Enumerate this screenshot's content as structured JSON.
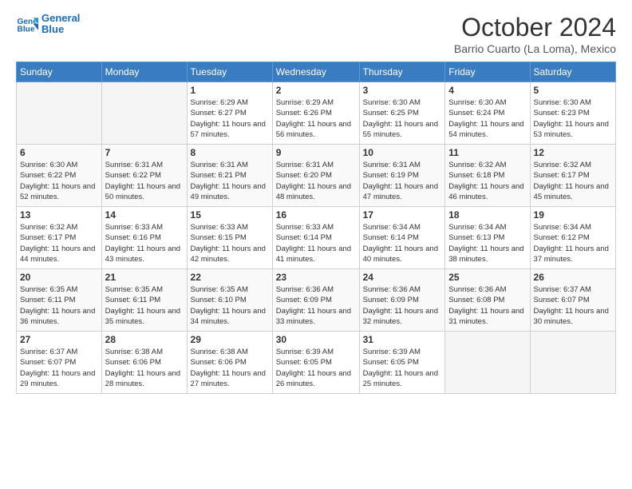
{
  "header": {
    "logo_line1": "General",
    "logo_line2": "Blue",
    "month_title": "October 2024",
    "subtitle": "Barrio Cuarto (La Loma), Mexico"
  },
  "weekdays": [
    "Sunday",
    "Monday",
    "Tuesday",
    "Wednesday",
    "Thursday",
    "Friday",
    "Saturday"
  ],
  "weeks": [
    [
      {
        "day": "",
        "empty": true
      },
      {
        "day": "",
        "empty": true
      },
      {
        "day": "1",
        "sunrise": "6:29 AM",
        "sunset": "6:27 PM",
        "daylight": "11 hours and 57 minutes."
      },
      {
        "day": "2",
        "sunrise": "6:29 AM",
        "sunset": "6:26 PM",
        "daylight": "11 hours and 56 minutes."
      },
      {
        "day": "3",
        "sunrise": "6:30 AM",
        "sunset": "6:25 PM",
        "daylight": "11 hours and 55 minutes."
      },
      {
        "day": "4",
        "sunrise": "6:30 AM",
        "sunset": "6:24 PM",
        "daylight": "11 hours and 54 minutes."
      },
      {
        "day": "5",
        "sunrise": "6:30 AM",
        "sunset": "6:23 PM",
        "daylight": "11 hours and 53 minutes."
      }
    ],
    [
      {
        "day": "6",
        "sunrise": "6:30 AM",
        "sunset": "6:22 PM",
        "daylight": "11 hours and 52 minutes."
      },
      {
        "day": "7",
        "sunrise": "6:31 AM",
        "sunset": "6:22 PM",
        "daylight": "11 hours and 50 minutes."
      },
      {
        "day": "8",
        "sunrise": "6:31 AM",
        "sunset": "6:21 PM",
        "daylight": "11 hours and 49 minutes."
      },
      {
        "day": "9",
        "sunrise": "6:31 AM",
        "sunset": "6:20 PM",
        "daylight": "11 hours and 48 minutes."
      },
      {
        "day": "10",
        "sunrise": "6:31 AM",
        "sunset": "6:19 PM",
        "daylight": "11 hours and 47 minutes."
      },
      {
        "day": "11",
        "sunrise": "6:32 AM",
        "sunset": "6:18 PM",
        "daylight": "11 hours and 46 minutes."
      },
      {
        "day": "12",
        "sunrise": "6:32 AM",
        "sunset": "6:17 PM",
        "daylight": "11 hours and 45 minutes."
      }
    ],
    [
      {
        "day": "13",
        "sunrise": "6:32 AM",
        "sunset": "6:17 PM",
        "daylight": "11 hours and 44 minutes."
      },
      {
        "day": "14",
        "sunrise": "6:33 AM",
        "sunset": "6:16 PM",
        "daylight": "11 hours and 43 minutes."
      },
      {
        "day": "15",
        "sunrise": "6:33 AM",
        "sunset": "6:15 PM",
        "daylight": "11 hours and 42 minutes."
      },
      {
        "day": "16",
        "sunrise": "6:33 AM",
        "sunset": "6:14 PM",
        "daylight": "11 hours and 41 minutes."
      },
      {
        "day": "17",
        "sunrise": "6:34 AM",
        "sunset": "6:14 PM",
        "daylight": "11 hours and 40 minutes."
      },
      {
        "day": "18",
        "sunrise": "6:34 AM",
        "sunset": "6:13 PM",
        "daylight": "11 hours and 38 minutes."
      },
      {
        "day": "19",
        "sunrise": "6:34 AM",
        "sunset": "6:12 PM",
        "daylight": "11 hours and 37 minutes."
      }
    ],
    [
      {
        "day": "20",
        "sunrise": "6:35 AM",
        "sunset": "6:11 PM",
        "daylight": "11 hours and 36 minutes."
      },
      {
        "day": "21",
        "sunrise": "6:35 AM",
        "sunset": "6:11 PM",
        "daylight": "11 hours and 35 minutes."
      },
      {
        "day": "22",
        "sunrise": "6:35 AM",
        "sunset": "6:10 PM",
        "daylight": "11 hours and 34 minutes."
      },
      {
        "day": "23",
        "sunrise": "6:36 AM",
        "sunset": "6:09 PM",
        "daylight": "11 hours and 33 minutes."
      },
      {
        "day": "24",
        "sunrise": "6:36 AM",
        "sunset": "6:09 PM",
        "daylight": "11 hours and 32 minutes."
      },
      {
        "day": "25",
        "sunrise": "6:36 AM",
        "sunset": "6:08 PM",
        "daylight": "11 hours and 31 minutes."
      },
      {
        "day": "26",
        "sunrise": "6:37 AM",
        "sunset": "6:07 PM",
        "daylight": "11 hours and 30 minutes."
      }
    ],
    [
      {
        "day": "27",
        "sunrise": "6:37 AM",
        "sunset": "6:07 PM",
        "daylight": "11 hours and 29 minutes."
      },
      {
        "day": "28",
        "sunrise": "6:38 AM",
        "sunset": "6:06 PM",
        "daylight": "11 hours and 28 minutes."
      },
      {
        "day": "29",
        "sunrise": "6:38 AM",
        "sunset": "6:06 PM",
        "daylight": "11 hours and 27 minutes."
      },
      {
        "day": "30",
        "sunrise": "6:39 AM",
        "sunset": "6:05 PM",
        "daylight": "11 hours and 26 minutes."
      },
      {
        "day": "31",
        "sunrise": "6:39 AM",
        "sunset": "6:05 PM",
        "daylight": "11 hours and 25 minutes."
      },
      {
        "day": "",
        "empty": true
      },
      {
        "day": "",
        "empty": true
      }
    ]
  ]
}
